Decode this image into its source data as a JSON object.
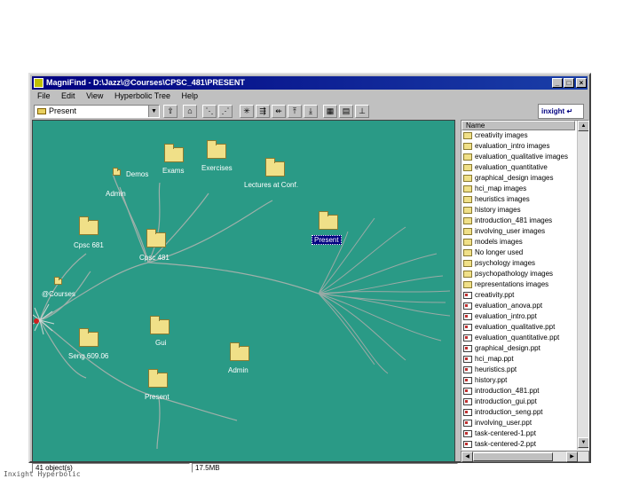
{
  "window": {
    "title": "MagniFind - D:\\Jazz\\@Courses\\CPSC_481\\PRESENT",
    "min": "_",
    "max": "□",
    "close": "×"
  },
  "menu": [
    "File",
    "Edit",
    "View",
    "Hyperbolic Tree",
    "Help"
  ],
  "toolbar": {
    "location_value": "Present",
    "logo_text": "inxight"
  },
  "tree": {
    "nodes": [
      {
        "label": "Admin"
      },
      {
        "label": "Demos"
      },
      {
        "label": "Exams"
      },
      {
        "label": "Exercises"
      },
      {
        "label": "Lectures at Conf."
      },
      {
        "label": "Cpsc 681"
      },
      {
        "label": "Cpsc 481"
      },
      {
        "label": "Present"
      },
      {
        "label": "@Courses"
      },
      {
        "label": "Gui"
      },
      {
        "label": "Seng 609.06"
      },
      {
        "label": "Admin"
      },
      {
        "label": "Present"
      }
    ]
  },
  "list": {
    "header": "Name",
    "items": [
      {
        "name": "creativity images",
        "type": "folder"
      },
      {
        "name": "evaluation_intro images",
        "type": "folder"
      },
      {
        "name": "evaluation_qualitative images",
        "type": "folder"
      },
      {
        "name": "evaluation_quantitative",
        "type": "folder"
      },
      {
        "name": "graphical_design images",
        "type": "folder"
      },
      {
        "name": "hci_map images",
        "type": "folder"
      },
      {
        "name": "heuristics images",
        "type": "folder"
      },
      {
        "name": "history images",
        "type": "folder"
      },
      {
        "name": "introduction_481 images",
        "type": "folder"
      },
      {
        "name": "involving_user images",
        "type": "folder"
      },
      {
        "name": "models images",
        "type": "folder"
      },
      {
        "name": "No longer used",
        "type": "folder"
      },
      {
        "name": "psychology images",
        "type": "folder"
      },
      {
        "name": "psychopathology images",
        "type": "folder"
      },
      {
        "name": "representations images",
        "type": "folder"
      },
      {
        "name": "creativity.ppt",
        "type": "doc"
      },
      {
        "name": "evaluation_anova.ppt",
        "type": "doc"
      },
      {
        "name": "evaluation_intro.ppt",
        "type": "doc"
      },
      {
        "name": "evaluation_qualitative.ppt",
        "type": "doc"
      },
      {
        "name": "evaluation_quantitative.ppt",
        "type": "doc"
      },
      {
        "name": "graphical_design.ppt",
        "type": "doc"
      },
      {
        "name": "hci_map.ppt",
        "type": "doc"
      },
      {
        "name": "heuristics.ppt",
        "type": "doc"
      },
      {
        "name": "history.ppt",
        "type": "doc"
      },
      {
        "name": "introduction_481.ppt",
        "type": "doc"
      },
      {
        "name": "introduction_gui.ppt",
        "type": "doc"
      },
      {
        "name": "introduction_seng.ppt",
        "type": "doc"
      },
      {
        "name": "involving_user.ppt",
        "type": "doc"
      },
      {
        "name": "task-centered-1.ppt",
        "type": "doc"
      },
      {
        "name": "task-centered-2.ppt",
        "type": "doc"
      }
    ]
  },
  "status": {
    "objects": "41 object(s)",
    "size": "17.5MB"
  },
  "footer": "Inxight Hyperbolic"
}
